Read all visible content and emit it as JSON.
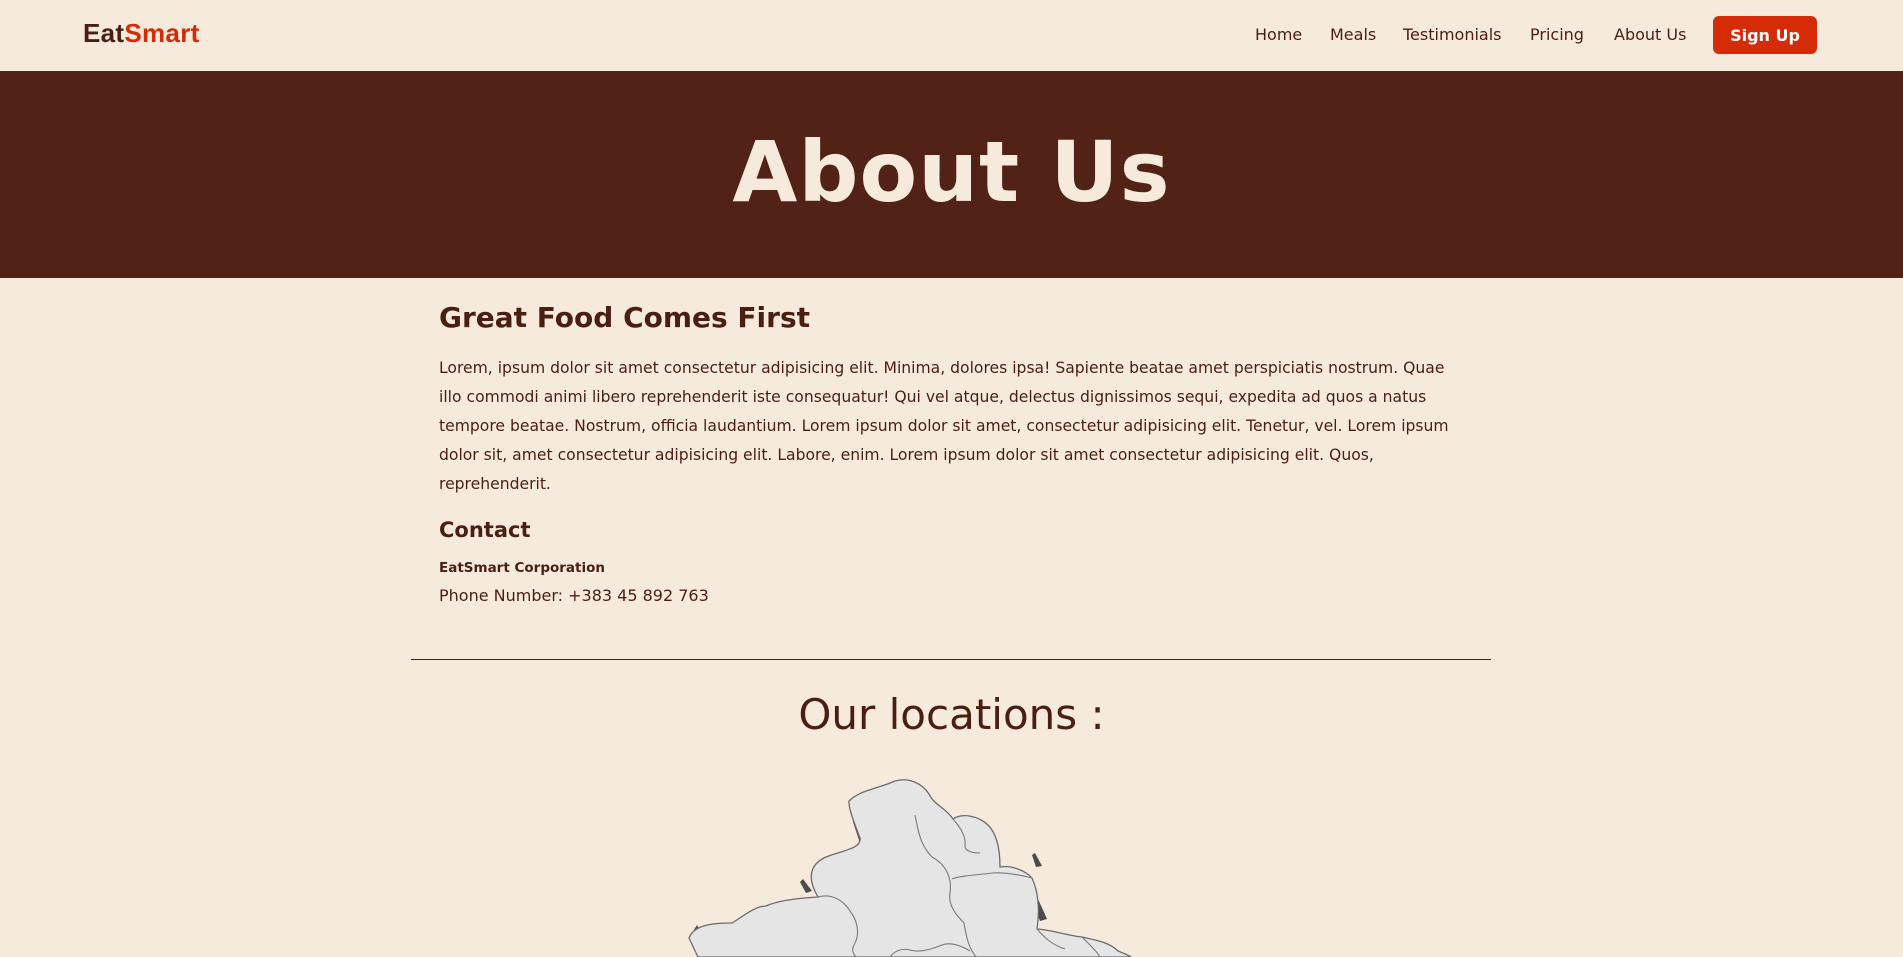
{
  "header": {
    "logo_part1": "Eat",
    "logo_part2": "Smart",
    "nav": [
      "Home",
      "Meals",
      "Testimonials",
      "Pricing",
      "About Us"
    ],
    "signup_label": "Sign Up"
  },
  "hero": {
    "title": "About Us"
  },
  "content": {
    "heading": "Great Food Comes First",
    "paragraph": "Lorem, ipsum dolor sit amet consectetur adipisicing elit. Minima, dolores ipsa! Sapiente beatae amet perspiciatis nostrum. Quae illo commodi animi libero reprehenderit iste consequatur! Qui vel atque, delectus dignissimos sequi, expedita ad quos a natus tempore beatae. Nostrum, officia laudantium. Lorem ipsum dolor sit amet, consectetur adipisicing elit. Tenetur, vel. Lorem ipsum dolor sit, amet consectetur adipisicing elit. Labore, enim. Lorem ipsum dolor sit amet consectetur adipisicing elit. Quos, reprehenderit.",
    "contact_title": "Contact",
    "company": "EatSmart Corporation",
    "phone": "Phone Number: +383 45 892 763"
  },
  "locations": {
    "title": "Our locations :"
  },
  "colors": {
    "background": "#f5eadc",
    "brand_dark": "#512215",
    "text": "#4a1f12",
    "accent": "#d52b07"
  }
}
